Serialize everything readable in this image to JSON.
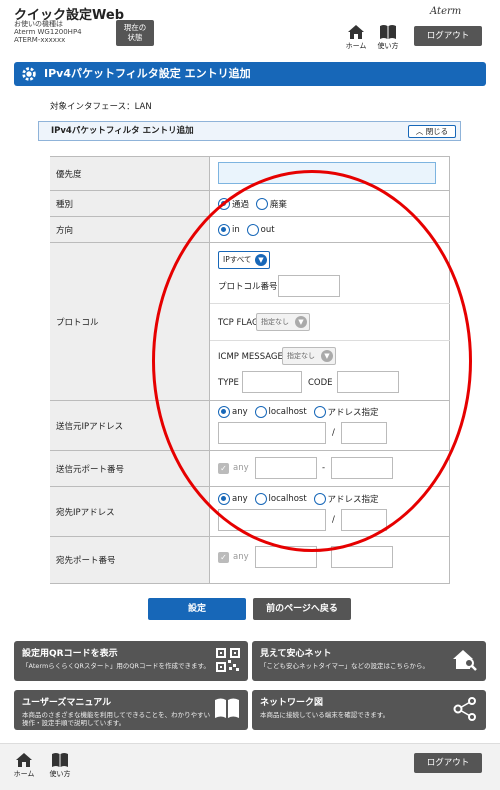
{
  "header": {
    "app_title": "クイック設定Web",
    "device_line1": "お使いの機種は",
    "device_line2": "Aterm WG1200HP4",
    "device_line3": "ATERM-xxxxxx",
    "status_button": "現在の\n状態",
    "home_label": "ホーム",
    "howto_label": "使い方",
    "brand_logo": "Aterm",
    "logout_label": "ログアウト"
  },
  "page": {
    "title": "IPv4パケットフィルタ設定 エントリ追加",
    "interface": "対象インタフェース：LAN",
    "section_title": "IPv4パケットフィルタ エントリ追加",
    "close_label": "閉じる"
  },
  "form": {
    "priority": {
      "label": "優先度",
      "value": ""
    },
    "type": {
      "label": "種別",
      "options": [
        "通過",
        "廃棄"
      ],
      "selected": "通過"
    },
    "direction": {
      "label": "方向",
      "options": [
        "in",
        "out"
      ],
      "selected": "in"
    },
    "protocol": {
      "label": "プロトコル",
      "select_value": "IPすべて",
      "number_label": "プロトコル番号",
      "tcp_flag_label": "TCP FLAG",
      "tcp_flag_value": "指定なし",
      "icmp_label": "ICMP MESSAGE",
      "icmp_value": "指定なし",
      "type_label": "TYPE",
      "code_label": "CODE"
    },
    "src_ip": {
      "label": "送信元IPアドレス",
      "options": [
        "any",
        "localhost",
        "アドレス指定"
      ],
      "selected": "any",
      "slash": "/"
    },
    "src_port": {
      "label": "送信元ポート番号",
      "any_label": "any",
      "dash": "-"
    },
    "dst_ip": {
      "label": "宛先IPアドレス",
      "options": [
        "any",
        "localhost",
        "アドレス指定"
      ],
      "selected": "any",
      "slash": "/"
    },
    "dst_port": {
      "label": "宛先ポート番号",
      "any_label": "any"
    }
  },
  "actions": {
    "submit": "設定",
    "back": "前のページへ戻る"
  },
  "cards": [
    {
      "title": "設定用QRコードを表示",
      "desc": "「AtermらくらくQRスタート」用のQRコードを作成できます。",
      "icon": "qr-code-icon"
    },
    {
      "title": "見えて安心ネット",
      "desc": "「こども安心ネットタイマー」などの設定はこちらから。",
      "icon": "home-search-icon"
    },
    {
      "title": "ユーザーズマニュアル",
      "desc": "本商品のさまざまな機能を利用してできることを、わかりやすい操作・設定手順で説明しています。",
      "icon": "book-icon"
    },
    {
      "title": "ネットワーク図",
      "desc": "本商品に接続している端末を確認できます。",
      "icon": "network-icon"
    }
  ],
  "footer": {
    "home_label": "ホーム",
    "howto_label": "使い方",
    "logout_label": "ログアウト"
  },
  "colors": {
    "accent": "#1767b8",
    "dark_button": "#555555",
    "annotation": "#e60000"
  }
}
